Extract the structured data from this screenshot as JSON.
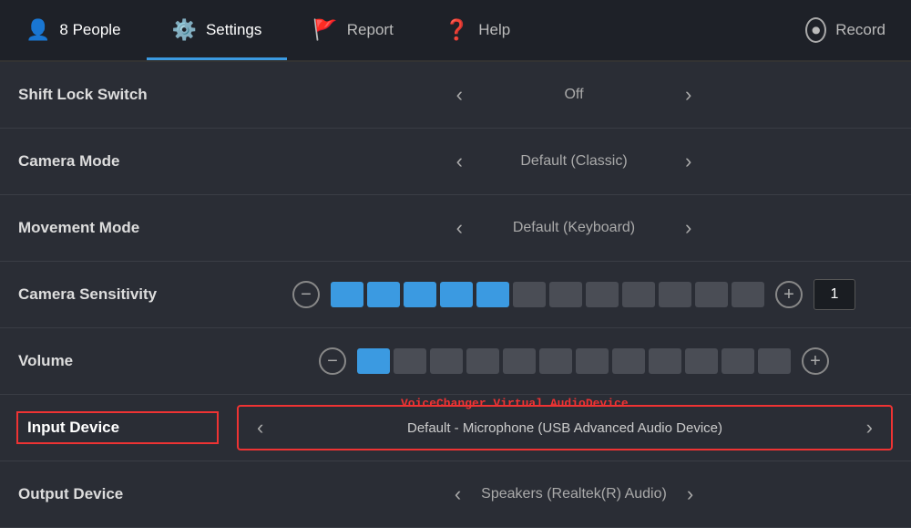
{
  "nav": {
    "items": [
      {
        "id": "people",
        "label": "8 People",
        "icon": "👤",
        "active": false
      },
      {
        "id": "settings",
        "label": "Settings",
        "icon": "⚙️",
        "active": true
      },
      {
        "id": "report",
        "label": "Report",
        "icon": "🚩",
        "active": false
      },
      {
        "id": "help",
        "label": "Help",
        "icon": "❓",
        "active": false
      },
      {
        "id": "record",
        "label": "Record",
        "icon": "⏺",
        "active": false
      }
    ]
  },
  "settings": {
    "rows": [
      {
        "id": "shift-lock",
        "label": "Shift Lock Switch",
        "value": "Off",
        "type": "select"
      },
      {
        "id": "camera-mode",
        "label": "Camera Mode",
        "value": "Default (Classic)",
        "type": "select"
      },
      {
        "id": "movement-mode",
        "label": "Movement Mode",
        "value": "Default (Keyboard)",
        "type": "select"
      },
      {
        "id": "camera-sensitivity",
        "label": "Camera Sensitivity",
        "type": "slider",
        "active_blocks": 5,
        "total_blocks": 12,
        "num_value": "1"
      },
      {
        "id": "volume",
        "label": "Volume",
        "type": "slider",
        "active_blocks": 1,
        "total_blocks": 12,
        "num_value": null
      }
    ],
    "input_device": {
      "label": "Input Device",
      "value": "Default - Microphone (USB Advanced Audio Device)",
      "voice_changer_label": "VoiceChanger Virtual AudioDevice",
      "highlighted": true
    },
    "output_device": {
      "label": "Output Device",
      "value": "Speakers (Realtek(R) Audio)"
    }
  }
}
